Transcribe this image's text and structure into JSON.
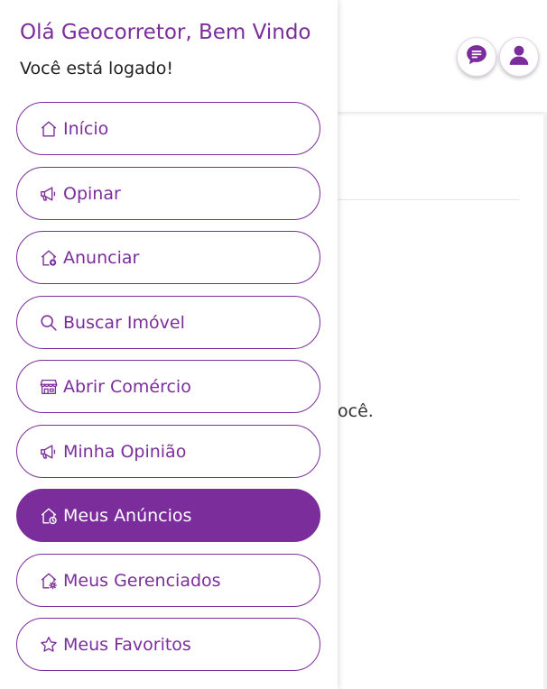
{
  "drawer": {
    "greeting": "Olá Geocorretor, Bem Vindo",
    "status": "Você está logado!",
    "items": [
      {
        "label": "Início",
        "icon": "home-icon",
        "active": false
      },
      {
        "label": "Opinar",
        "icon": "megaphone-icon",
        "active": false
      },
      {
        "label": "Anunciar",
        "icon": "home-add-icon",
        "active": false
      },
      {
        "label": "Buscar Imóvel",
        "icon": "search-icon",
        "active": false
      },
      {
        "label": "Abrir Comércio",
        "icon": "shop-icon",
        "active": false
      },
      {
        "label": "Minha Opinião",
        "icon": "megaphone-icon",
        "active": false
      },
      {
        "label": "Meus Anúncios",
        "icon": "home-clock-icon",
        "active": true
      },
      {
        "label": "Meus Gerenciados",
        "icon": "home-gear-icon",
        "active": false
      },
      {
        "label": "Meus Favoritos",
        "icon": "star-icon",
        "active": false
      }
    ]
  },
  "header": {
    "chat_icon": "chat-icon",
    "user_icon": "user-icon"
  },
  "background": {
    "visible_text": "ocê."
  },
  "colors": {
    "accent": "#7b2d9b",
    "text": "#222222",
    "background": "#ffffff"
  }
}
